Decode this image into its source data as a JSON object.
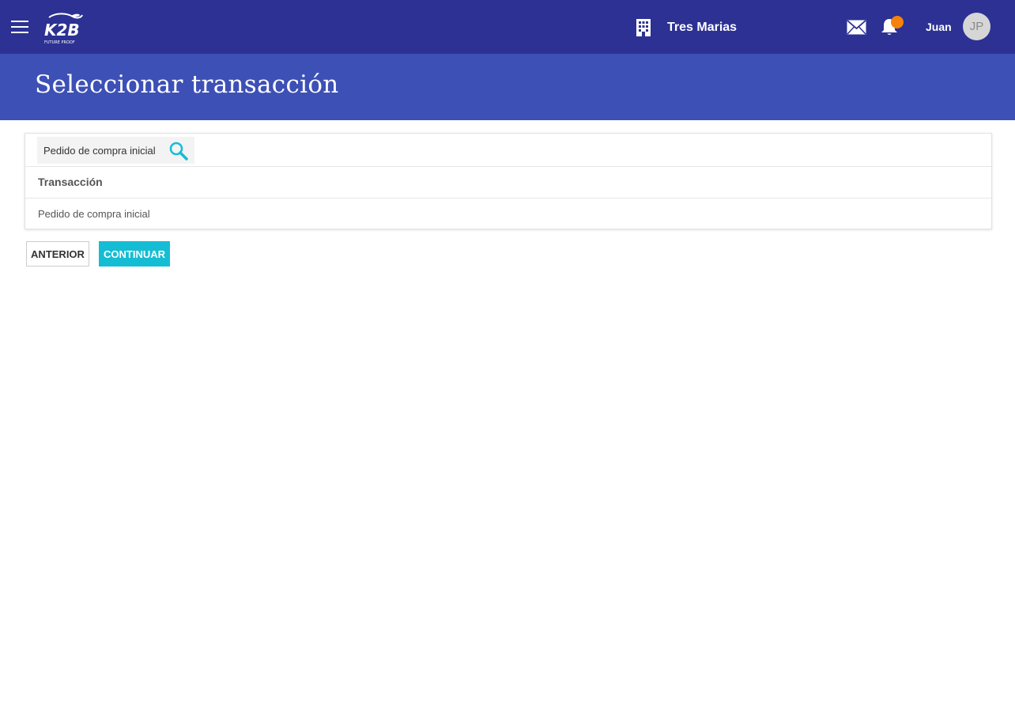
{
  "header": {
    "company_name": "Tres Marias",
    "user_name": "Juan",
    "user_initials": "JP",
    "logo_text": "K2B",
    "logo_tagline": "FUTURE PROOF",
    "notification_color": "#f5820a"
  },
  "page": {
    "title": "Seleccionar transacción"
  },
  "filter": {
    "value": "Pedido de compra inicial"
  },
  "grid": {
    "column_header": "Transacción",
    "rows": [
      "Pedido de compra inicial"
    ]
  },
  "actions": {
    "previous_label": "ANTERIOR",
    "continue_label": "CONTINUAR"
  },
  "colors": {
    "topbar": "#2c3193",
    "titlebar": "#3d50b6",
    "accent": "#14bdd4"
  },
  "icons": [
    "menu-icon",
    "building-icon",
    "mail-icon",
    "bell-icon",
    "search-icon"
  ]
}
